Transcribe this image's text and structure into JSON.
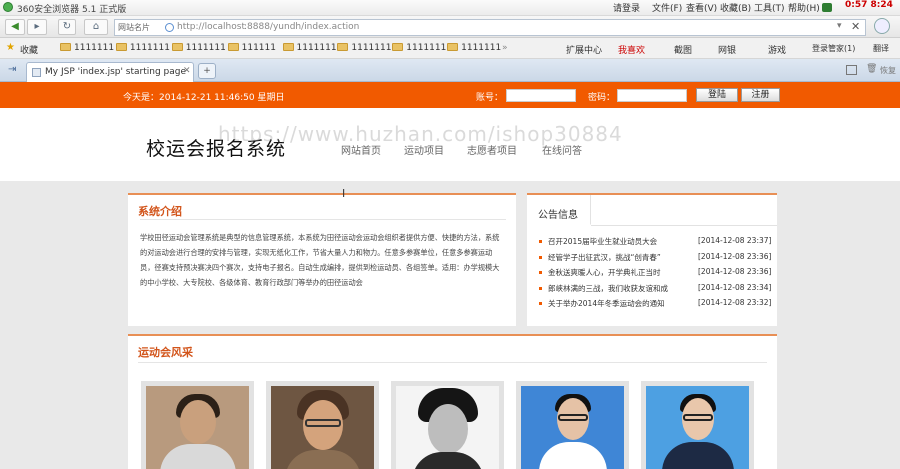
{
  "browser": {
    "title": "360安全浏览器 5.1 正式版",
    "menu": [
      "请登录",
      "文件(F)",
      "查看(V)",
      "收藏(B)",
      "工具(T)",
      "帮助(H)"
    ],
    "clock": "0:57 8:24",
    "addr_label": "网站名片",
    "url_host": "http://localhost",
    "url_rest": ":8888/yundh/index.action",
    "fav_label": "收藏",
    "bookmarks": [
      "1111111",
      "1111111",
      "1111111",
      "111111",
      "1111111",
      "1111111",
      "1111111",
      "1111111"
    ],
    "ext": [
      "扩展中心",
      "我喜欢",
      "截图",
      "网银",
      "游戏",
      "登录管家(1)",
      "翻译"
    ],
    "tab_title": "My JSP 'index.jsp' starting page",
    "restore_label": "恢复"
  },
  "topbar": {
    "date": "今天是：2014-12-21 11:46:50 星期日",
    "account_label": "账号：",
    "password_label": "密码：",
    "login": "登陆",
    "register": "注册"
  },
  "site": {
    "title": "校运会报名系统",
    "nav": [
      "网站首页",
      "运动项目",
      "志愿者项目",
      "在线问答"
    ],
    "watermark": "https://www.huzhan.com/ishop30884"
  },
  "intro": {
    "title": "系统介绍",
    "body": "学校田径运动会管理系统是典型的信息管理系统，本系统为田径运动会运动会组织者提供方便、快捷的方法，系统的对运动会进行合理的安排与管理，实现无纸化工作，节省大量人力和物力。任意多参赛单位，任意多参赛运动员，径赛支持预决赛决四个赛次，支持电子报名。自动生成编排，提供到检运动员、各组签单。适用：办学规模大的中小学校、大专院校、各级体育、教育行政部门等举办的田径运动会"
  },
  "notice": {
    "title": "公告信息",
    "items": [
      {
        "text": "召开2015届毕业生就业动员大会",
        "date": "[2014-12-08 23:37]"
      },
      {
        "text": "经管学子出征武汉，挑战“创青春”",
        "date": "[2014-12-08 23:36]"
      },
      {
        "text": "金秋送爽暖人心，开学典礼正当时",
        "date": "[2014-12-08 23:36]"
      },
      {
        "text": "郎峡林满的三战，我们收获友谊和成",
        "date": "[2014-12-08 23:34]"
      },
      {
        "text": "关于举办2014年冬季运动会的通知",
        "date": "[2014-12-08 23:32]"
      }
    ]
  },
  "gallery": {
    "title": "运动会风采",
    "photos": [
      {
        "bg": "#b89a7e",
        "skin": "#c9a07d",
        "hair": "#2b2017",
        "shirt": "#d9d9d9"
      },
      {
        "bg": "#6e5642",
        "skin": "#d4a37c",
        "hair": "#4a3324",
        "shirt": "#8a6e53"
      },
      {
        "bg": "#f4f4f4",
        "skin": "#bdbdbd",
        "hair": "#151515",
        "shirt": "#2a2a2a"
      },
      {
        "bg": "#3f86d6",
        "skin": "#e5c2a6",
        "hair": "#111111",
        "shirt": "#ffffff"
      },
      {
        "bg": "#4da0e2",
        "skin": "#e9c7ab",
        "hair": "#101010",
        "shirt": "#1d2a44"
      }
    ]
  },
  "colors": {
    "orange": "#f15a00",
    "section_title": "#d2541a"
  }
}
